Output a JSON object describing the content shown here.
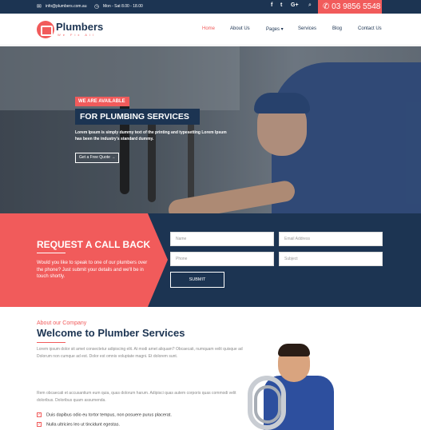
{
  "topbar": {
    "email": "info@plumbers.com.au",
    "hours": "Mon - Sat 8.00 - 18.00",
    "social": [
      "f",
      "t",
      "G+"
    ],
    "phone": "03 9856 5548"
  },
  "header": {
    "brand": "Plumbers",
    "tagline": "We Fix All",
    "nav": [
      {
        "label": "Home",
        "active": true
      },
      {
        "label": "About Us"
      },
      {
        "label": "Pages ▾"
      },
      {
        "label": "Services"
      },
      {
        "label": "Blog"
      },
      {
        "label": "Contact Us"
      }
    ]
  },
  "hero": {
    "badge": "WE ARE AVAILABLE",
    "title": "FOR PLUMBING SERVICES",
    "text": "Lorem Ipsum is simply dummy text of the printing and typesetting Lorem Ipsum has been the industry's standard dummy.",
    "button": "Get a Free Quote"
  },
  "callback": {
    "title": "REQUEST A CALL BACK",
    "text": "Would you like to speak to one of our plumbers over the phone? Just submit your details and we'll be in touch shortly.",
    "placeholders": {
      "name": "Name",
      "email": "Email Address",
      "phone": "Phone",
      "subject": "Subject"
    },
    "submit": "SUBMIT"
  },
  "about": {
    "small": "About our Company",
    "title": "Welcome to Plumber Services",
    "p1": "Lorem ipsum dolor sit amet consectetur adipiscing elit. At modi amet aliquam? Obcaecati, numquam velit quisque ad Dolorum non cumque ad est. Dolor est omnis voluptate magni. Et dolorem sunt.",
    "p2": "Rem obcaecati et accusantium eum quia, quas dolorum harum. Adipisci quas autem corporis quas commodi velit doloribus. Doloribus quam assumenda.",
    "checks": [
      "Duis dapibus odio eu tortor tempus, non posuere purus placerat.",
      "Nulla ultricies leo ut tincidunt egestas."
    ]
  },
  "colors": {
    "navy": "#1c3452",
    "accent": "#f15b5b"
  },
  "icons": {
    "email": "envelope-icon",
    "clock": "clock-icon",
    "search": "search-icon",
    "phone": "phone-icon",
    "check": "check-icon"
  }
}
